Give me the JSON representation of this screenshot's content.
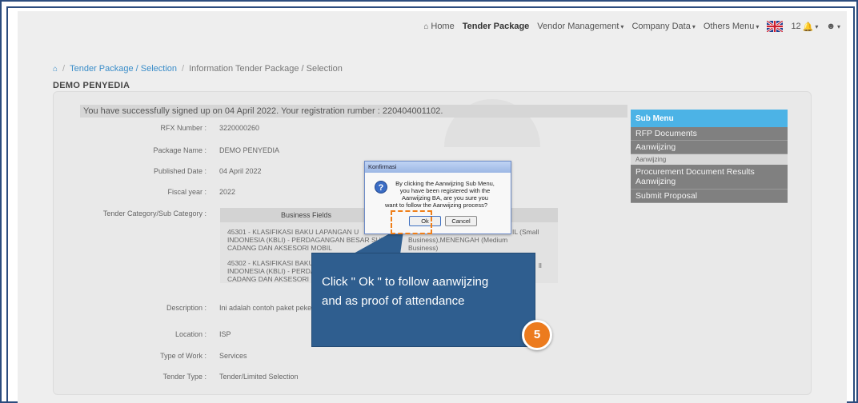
{
  "navbar": {
    "home": "Home",
    "tender_package": "Tender Package",
    "vendor_management": "Vendor Management",
    "company_data": "Company Data",
    "others_menu": "Others Menu",
    "notification_count": "12"
  },
  "breadcrumb": {
    "link": "Tender Package / Selection",
    "current": "Information Tender Package / Selection"
  },
  "page_title": "DEMO PENYEDIA",
  "alert": "You have successfully signed up on 04 April 2022. Your registration rumber : 220404001102.",
  "details": {
    "rfx_label": "RFX Number :",
    "rfx_value": "3220000260",
    "package_label": "Package Name :",
    "package_value": "DEMO PENYEDIA",
    "published_label": "Published Date :",
    "published_value": "04 April 2022",
    "fiscal_label": "Fiscal year :",
    "fiscal_value": "2022",
    "category_label": "Tender Category/Sub Category :",
    "description_label": "Description :",
    "description_value": "Ini adalah contoh paket peke",
    "location_label": "Location :",
    "location_value": "ISP",
    "work_label": "Type of Work :",
    "work_value": "Services",
    "tender_type_label": "Tender Type :",
    "tender_type_value": "Tender/Limited Selection"
  },
  "business_fields": {
    "header": "Business Fields",
    "row1_a": "45301 - KLASIFIKASI BAKU LAPANGAN U",
    "row1_b": "INDONESIA (KBLI) - PERDAGANGAN BESAR SUKU",
    "row1_c": "CADANG DAN AKSESORI MOBIL",
    "row1_right_a": "IL (Small",
    "row1_right_b": "Business),MENENGAH (Medium",
    "row1_right_c": "Business)",
    "row2_a": "45302 - KLASIFIKASI BAKU",
    "row2_b": "INDONESIA (KBLI) - PERDA",
    "row2_c": "CADANG DAN AKSESORI M",
    "row2_right": "ll"
  },
  "submenu": {
    "header": "Sub Menu",
    "rfp_documents": "RFP Documents",
    "aanwijzing": "Aanwijzing",
    "aanwijzing_sub": "Aanwijzing",
    "procurement_line1": "Procurement Document Results",
    "procurement_line2": "Aanwijzing",
    "submit_proposal": "Submit Proposal"
  },
  "modal": {
    "title": "Konfirmasi",
    "line1": "By clicking the Aanwijzing Sub Menu,",
    "line2": "you have been registered with the",
    "line3": "Aanwijzing BA, are you sure you",
    "line4": "want to follow the Aanwijzing process?",
    "ok": "Ok",
    "cancel": "Cancel"
  },
  "callout": {
    "line1": "Click \" Ok \" to follow aanwijzing",
    "line2": "and as proof of attendance"
  },
  "step_number": "5",
  "colors": {
    "frame": "#2b4c7e",
    "callout": "#2f5e8f",
    "badge": "#ec7b1e",
    "submenu_header": "#4cb3e6",
    "link": "#3a8dc9"
  }
}
